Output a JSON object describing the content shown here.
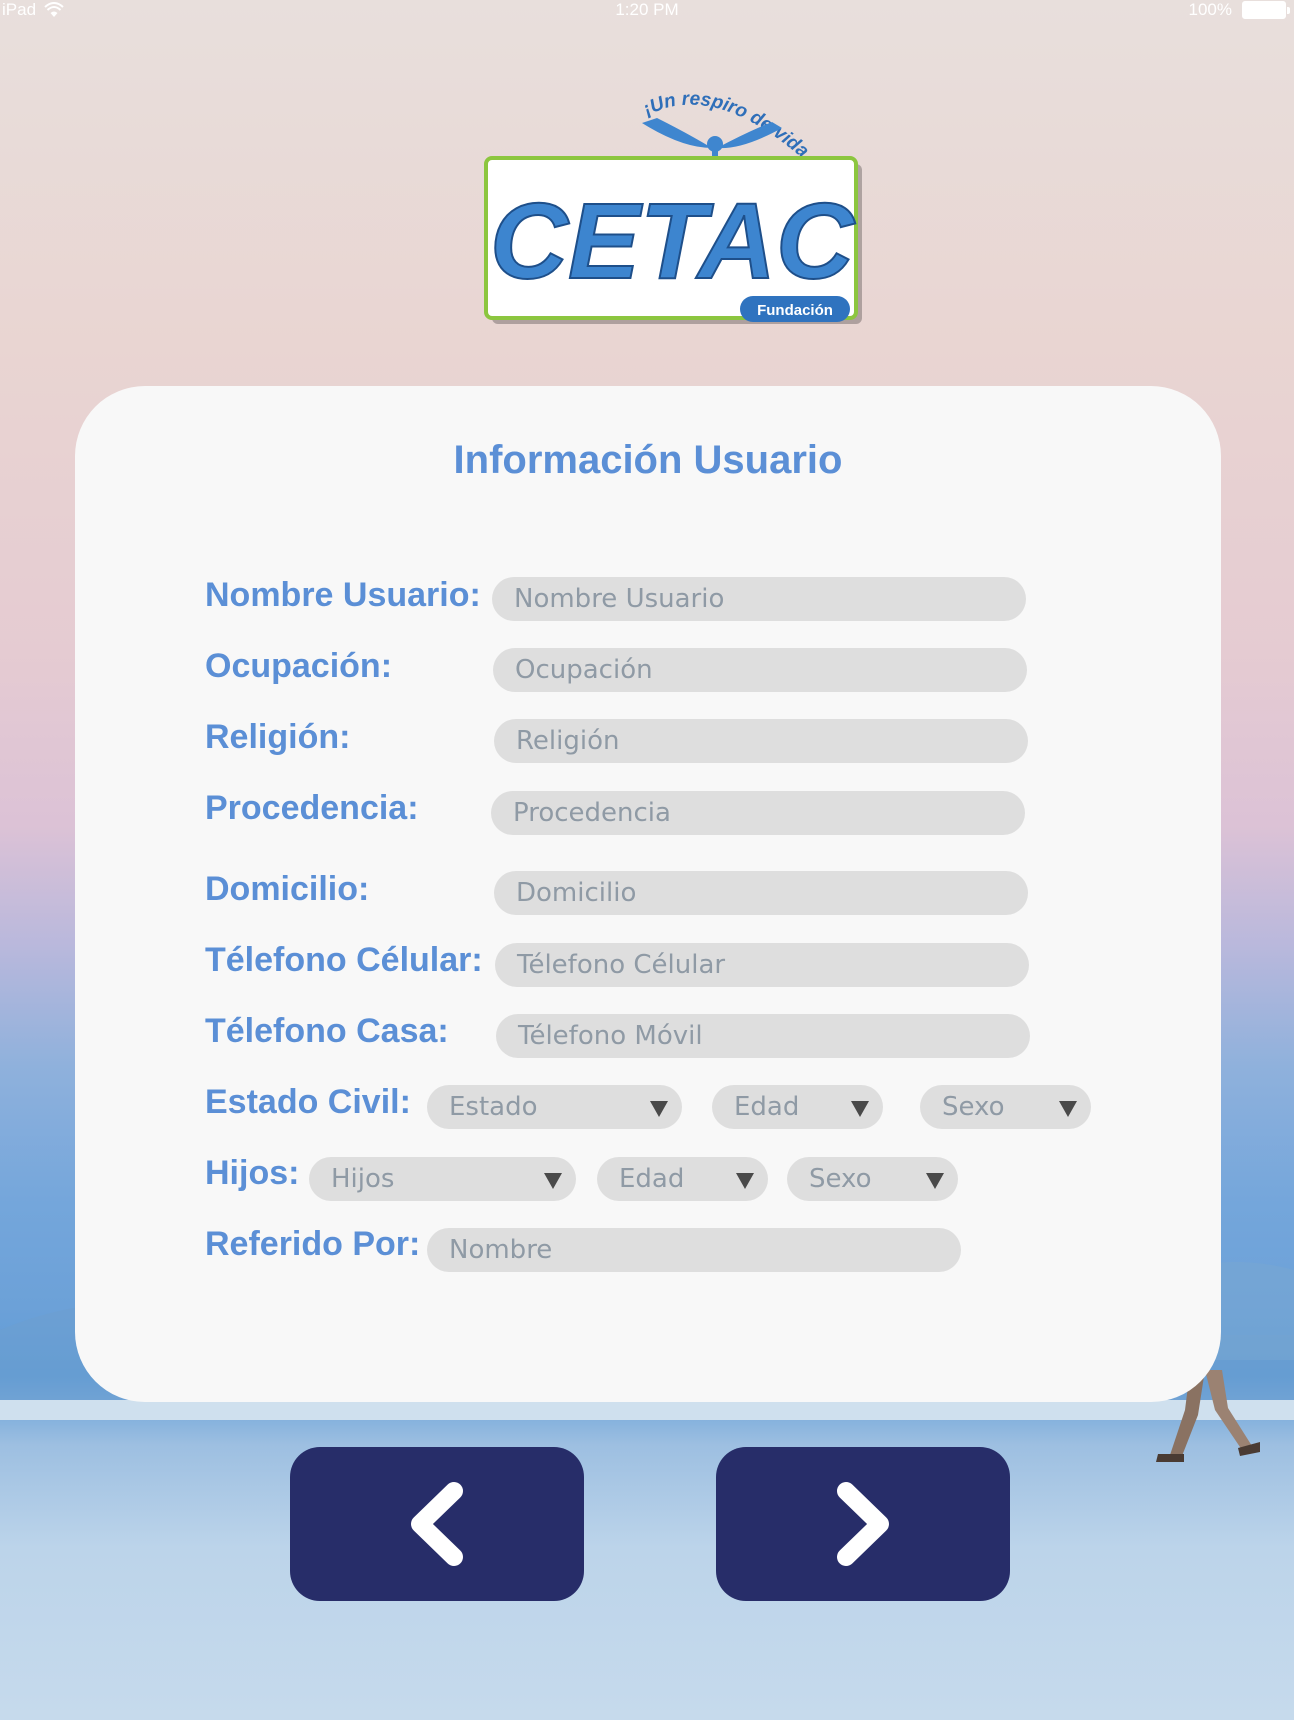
{
  "status_bar": {
    "device": "iPad",
    "time": "1:20 PM",
    "battery": "100%"
  },
  "logo": {
    "slogan": "¡Un respiro de vida!",
    "brand": "CETAC",
    "subtitle": "Fundación"
  },
  "form": {
    "title": "Información Usuario",
    "fields": {
      "nombre": {
        "label": "Nombre Usuario:",
        "placeholder": "Nombre Usuario"
      },
      "ocupacion": {
        "label": "Ocupación:",
        "placeholder": "Ocupación"
      },
      "religion": {
        "label": "Religión:",
        "placeholder": "Religión"
      },
      "procedencia": {
        "label": "Procedencia:",
        "placeholder": "Procedencia"
      },
      "domicilio": {
        "label": "Domicilio:",
        "placeholder": "Domicilio"
      },
      "celular": {
        "label": "Télefono Célular:",
        "placeholder": "Télefono Célular"
      },
      "casa": {
        "label": "Télefono Casa:",
        "placeholder": "Télefono Móvil"
      },
      "estado_civil": {
        "label": "Estado Civil:",
        "estado": "Estado",
        "edad": "Edad",
        "sexo": "Sexo"
      },
      "hijos": {
        "label": "Hijos:",
        "hijos": "Hijos",
        "edad": "Edad",
        "sexo": "Sexo"
      },
      "referido": {
        "label": "Referido Por:",
        "placeholder": "Nombre"
      }
    }
  },
  "navigation": {
    "back_icon": "chevron-left-icon",
    "next_icon": "chevron-right-icon"
  },
  "colors": {
    "label_blue": "#5b8fd6",
    "button_navy": "#272d69",
    "field_gray": "#dedede",
    "card_bg": "#f8f8f8"
  }
}
